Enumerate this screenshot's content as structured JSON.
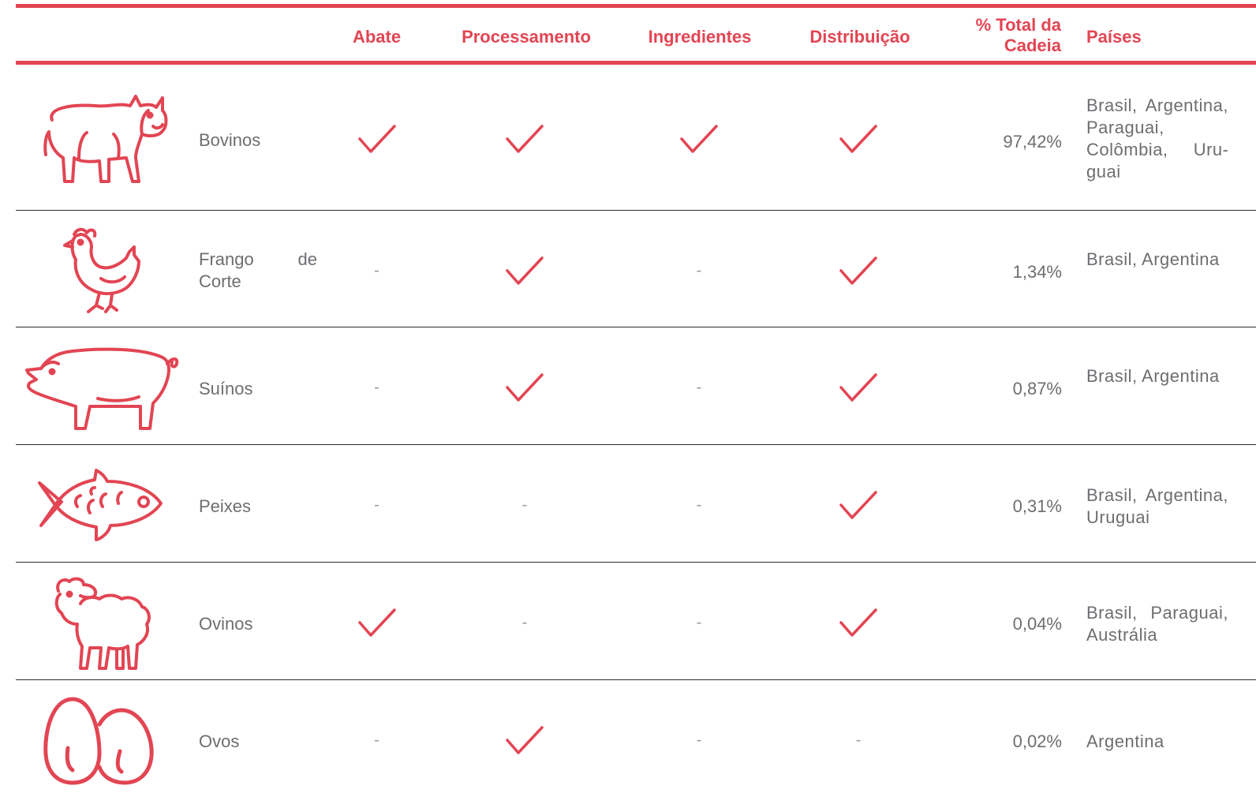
{
  "colors": {
    "accent": "#e24553",
    "text": "#6d6e71",
    "rule": "#2d2d2d"
  },
  "header": {
    "abate": "Abate",
    "processamento": "Processamento",
    "ingredientes": "Ingredientes",
    "distribuicao": "Distribuição",
    "pct_line1": "% Total da",
    "pct_line2": "Cadeia",
    "paises": "Países"
  },
  "rows": [
    {
      "icon": "cattle-icon",
      "label": "Bovinos",
      "abate": true,
      "processamento": true,
      "ingredientes": true,
      "distribuicao": true,
      "pct": "97,42%",
      "countries": "Brasil, Argen­tina, Paraguai, Colômbia, Uru­guai"
    },
    {
      "icon": "chicken-icon",
      "label": "Frango de Corte",
      "abate": false,
      "processamento": true,
      "ingredientes": false,
      "distribuicao": true,
      "pct": "1,34%",
      "countries": "Brasil, Argenti­na"
    },
    {
      "icon": "pig-icon",
      "label": "Suínos",
      "abate": false,
      "processamento": true,
      "ingredientes": false,
      "distribuicao": true,
      "pct": "0,87%",
      "countries": "Brasil, Argenti­na"
    },
    {
      "icon": "fish-icon",
      "label": "Peixes",
      "abate": false,
      "processamento": false,
      "ingredientes": false,
      "distribuicao": true,
      "pct": "0,31%",
      "countries": "Brasil, Argenti­na, Uruguai"
    },
    {
      "icon": "sheep-icon",
      "label": "Ovinos",
      "abate": true,
      "processamento": false,
      "ingredientes": false,
      "distribuicao": true,
      "pct": "0,04%",
      "countries": "Brasil, Para­guai, Austrália"
    },
    {
      "icon": "eggs-icon",
      "label": "Ovos",
      "abate": false,
      "processamento": true,
      "ingredientes": false,
      "distribuicao": false,
      "pct": "0,02%",
      "countries": "Argentina"
    }
  ],
  "dash": "-"
}
